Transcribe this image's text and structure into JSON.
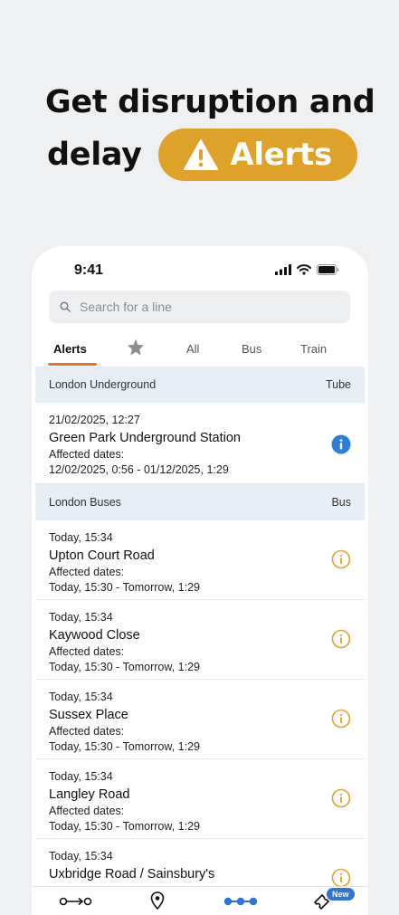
{
  "headline": {
    "line1": "Get disruption and",
    "line2": "delay",
    "pill": "Alerts",
    "pill_icon": "warning-icon",
    "pill_color": "#dea12a"
  },
  "status_bar": {
    "time": "9:41",
    "icons": [
      "signal-icon",
      "wifi-icon",
      "battery-icon"
    ]
  },
  "search": {
    "placeholder": "Search for a line",
    "value": ""
  },
  "tabs": [
    {
      "label": "Alerts",
      "active": true
    },
    {
      "label": "",
      "icon": "star-icon",
      "active": false
    },
    {
      "label": "All",
      "active": false
    },
    {
      "label": "Bus",
      "active": false
    },
    {
      "label": "Train",
      "active": false
    }
  ],
  "accent_color": "#e4762a",
  "sections": [
    {
      "title": "London Underground",
      "mode": "Tube",
      "items": [
        {
          "when": "21/02/2025, 12:27",
          "place": "Green Park Underground Station",
          "dates_label": "Affected dates:",
          "dates": "12/02/2025, 0:56 - 01/12/2025, 1:29",
          "icon": "info-filled-icon",
          "icon_color": "#2a7fd9"
        }
      ]
    },
    {
      "title": "London Buses",
      "mode": "Bus",
      "items": [
        {
          "when": "Today, 15:34",
          "place": "Upton Court Road",
          "dates_label": "Affected dates:",
          "dates": "Today, 15:30 - Tomorrow, 1:29",
          "icon": "info-outline-icon",
          "icon_color": "#dea12a"
        },
        {
          "when": "Today, 15:34",
          "place": "Kaywood Close",
          "dates_label": "Affected dates:",
          "dates": "Today, 15:30 - Tomorrow, 1:29",
          "icon": "info-outline-icon",
          "icon_color": "#dea12a"
        },
        {
          "when": "Today, 15:34",
          "place": "Sussex Place",
          "dates_label": "Affected dates:",
          "dates": "Today, 15:30 - Tomorrow, 1:29",
          "icon": "info-outline-icon",
          "icon_color": "#dea12a"
        },
        {
          "when": "Today, 15:34",
          "place": "Langley Road",
          "dates_label": "Affected dates:",
          "dates": "Today, 15:30 - Tomorrow, 1:29",
          "icon": "info-outline-icon",
          "icon_color": "#dea12a"
        },
        {
          "when": "Today, 15:34",
          "place": "Uxbridge Road / Sainsbury's",
          "dates_label": "",
          "dates": "",
          "icon": "info-outline-icon",
          "icon_color": "#dea12a"
        }
      ]
    }
  ],
  "bottom_nav": {
    "items": [
      {
        "icon": "journey-icon"
      },
      {
        "icon": "location-pin-icon"
      },
      {
        "icon": "more-dots-icon",
        "active": true
      },
      {
        "icon": "ticket-icon",
        "badge": "New"
      }
    ],
    "active_color": "#2e74d6"
  }
}
